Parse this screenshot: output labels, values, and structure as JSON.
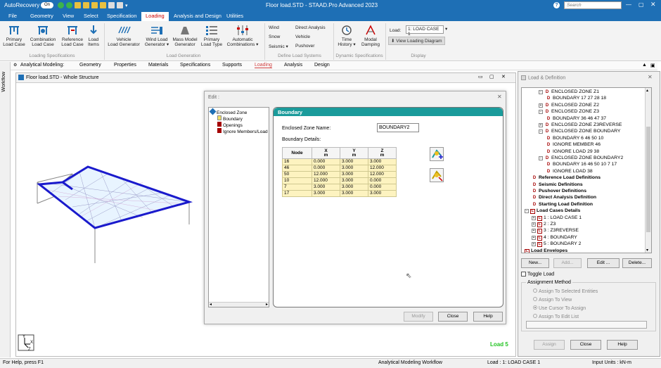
{
  "title_bar": {
    "app_name": "AutoRecovery",
    "toggle_state": "On",
    "document_title": "Floor load.STD - STAAD.Pro Advanced 2023",
    "search_placeholder": "Search"
  },
  "menu": {
    "items": [
      "File",
      "Geometry",
      "View",
      "Select",
      "Specification",
      "Loading",
      "Analysis and Design",
      "Utilities"
    ],
    "active": "Loading"
  },
  "ribbon": {
    "loading_specifications": {
      "group_label": "Loading Specifications",
      "buttons": [
        {
          "line1": "Primary",
          "line2": "Load Case"
        },
        {
          "line1": "Combination",
          "line2": "Load Case"
        },
        {
          "line1": "Reference",
          "line2": "Load Case"
        },
        {
          "line1": "Load",
          "line2": "Items"
        }
      ]
    },
    "load_generation": {
      "group_label": "Load Generation",
      "buttons": [
        {
          "line1": "Vehicle",
          "line2": "Load Generator"
        },
        {
          "line1": "Wind Load",
          "line2": "Generator ▾"
        },
        {
          "line1": "Mass Model",
          "line2": "Generator"
        },
        {
          "line1": "Primary",
          "line2": "Load Type"
        },
        {
          "line1": "Automatic",
          "line2": "Combinations ▾"
        }
      ]
    },
    "define_load_systems": {
      "group_label": "Define Load Systems",
      "items": [
        "Wind",
        "Snow",
        "Seismic ▾",
        "Direct Analysis",
        "Vehicle",
        "Pushover"
      ]
    },
    "dynamic_specifications": {
      "group_label": "Dynamic Specifications",
      "buttons": [
        {
          "line1": "Time",
          "line2": "History ▾"
        },
        {
          "line1": "Modal",
          "line2": "Damping"
        }
      ]
    },
    "display": {
      "group_label": "Display",
      "load_label": "Load:",
      "load_value": "1: LOAD CASE 1",
      "view_diagram": "View Loading Diagram"
    }
  },
  "workflow_bar": {
    "items": [
      "Analytical Modeling:",
      "Geometry",
      "Properties",
      "Materials",
      "Specifications",
      "Supports",
      "Loading",
      "Analysis",
      "Design"
    ],
    "active": "Loading",
    "side_label": "Workflow"
  },
  "structure_window": {
    "title": "Floor load.STD - Whole Structure",
    "load_indicator": "Load 5",
    "axis_x": "X",
    "axis_y": "Y",
    "axis_z": "Z"
  },
  "edit_dialog": {
    "title": "Edit :",
    "tree": [
      "Enclosed Zone",
      "Boundary",
      "Openings",
      "Ignore Members/Load"
    ],
    "panel_title": "Boundary",
    "zone_name_label": "Enclosed Zone Name:",
    "zone_name_value": "BOUNDARY2",
    "details_label": "Boundary Details:",
    "columns": [
      {
        "name": "Node",
        "unit": ""
      },
      {
        "name": "X",
        "unit": "m"
      },
      {
        "name": "Y",
        "unit": "m"
      },
      {
        "name": "Z",
        "unit": "m"
      }
    ],
    "rows": [
      [
        "16",
        "0.000",
        "3.000",
        "3.000"
      ],
      [
        "46",
        "0.000",
        "3.000",
        "12.000"
      ],
      [
        "50",
        "12.000",
        "3.000",
        "12.000"
      ],
      [
        "10",
        "12.000",
        "3.000",
        "0.000"
      ],
      [
        "7",
        "3.000",
        "3.000",
        "0.000"
      ],
      [
        "17",
        "3.000",
        "3.000",
        "3.000"
      ]
    ],
    "buttons": {
      "modify": "Modify",
      "close": "Close",
      "help": "Help"
    }
  },
  "load_panel": {
    "title": "Load & Definition",
    "tree": [
      {
        "indent": 2,
        "type": "D",
        "expand": "-",
        "text": "ENCLOSED ZONE Z1",
        "bold": false
      },
      {
        "indent": 3,
        "type": "D",
        "expand": "",
        "text": "BOUNDARY 17 27 28 18",
        "bold": false
      },
      {
        "indent": 2,
        "type": "D",
        "expand": "+",
        "text": "ENCLOSED ZONE Z2",
        "bold": false
      },
      {
        "indent": 2,
        "type": "D",
        "expand": "-",
        "text": "ENCLOSED ZONE Z3",
        "bold": false
      },
      {
        "indent": 3,
        "type": "D",
        "expand": "",
        "text": "BOUNDARY 36 46 47 37",
        "bold": false
      },
      {
        "indent": 2,
        "type": "D",
        "expand": "+",
        "text": "ENCLOSED ZONE Z3REVERSE",
        "bold": false
      },
      {
        "indent": 2,
        "type": "D",
        "expand": "-",
        "text": "ENCLOSED ZONE BOUNDARY",
        "bold": false
      },
      {
        "indent": 3,
        "type": "D",
        "expand": "",
        "text": "BOUNDARY 6 46 50 10",
        "bold": false
      },
      {
        "indent": 3,
        "type": "D",
        "expand": "",
        "text": "IGNORE MEMBER 46",
        "bold": false
      },
      {
        "indent": 3,
        "type": "D",
        "expand": "",
        "text": "IGNORE LOAD 29 38",
        "bold": false
      },
      {
        "indent": 2,
        "type": "D",
        "expand": "-",
        "text": "ENCLOSED ZONE BOUNDARY2",
        "bold": false
      },
      {
        "indent": 3,
        "type": "D",
        "expand": "",
        "text": "BOUNDARY 16 46 50 10 7 17",
        "bold": false
      },
      {
        "indent": 3,
        "type": "D",
        "expand": "",
        "text": "IGNORE LOAD 38",
        "bold": false
      },
      {
        "indent": 1,
        "type": "D",
        "expand": "",
        "text": "Reference Load Definitions",
        "bold": true
      },
      {
        "indent": 1,
        "type": "D",
        "expand": "",
        "text": "Seismic Definitions",
        "bold": true
      },
      {
        "indent": 1,
        "type": "D",
        "expand": "",
        "text": "Pushover Definitions",
        "bold": true
      },
      {
        "indent": 1,
        "type": "D",
        "expand": "",
        "text": "Direct Analysis Definition",
        "bold": true
      },
      {
        "indent": 1,
        "type": "D",
        "expand": "",
        "text": "Starting Load Definition",
        "bold": true
      },
      {
        "indent": 0,
        "type": "L",
        "expand": "-",
        "text": "Load Cases Details",
        "bold": true
      },
      {
        "indent": 1,
        "type": "L",
        "expand": "+",
        "text": "1 : LOAD CASE 1",
        "bold": false
      },
      {
        "indent": 1,
        "type": "L",
        "expand": "+",
        "text": "2 : Z3",
        "bold": false
      },
      {
        "indent": 1,
        "type": "L",
        "expand": "+",
        "text": "3 : Z3REVERSE",
        "bold": false
      },
      {
        "indent": 1,
        "type": "L",
        "expand": "+",
        "text": "4 : BOUNDARY",
        "bold": false
      },
      {
        "indent": 1,
        "type": "L",
        "expand": "+",
        "text": "5 : BOUNDARY 2",
        "bold": false
      },
      {
        "indent": 0,
        "type": "L",
        "expand": "",
        "text": "Load Envelopes",
        "bold": true
      }
    ],
    "buttons": {
      "new": "New...",
      "add": "Add...",
      "edit": "Edit ...",
      "delete": "Delete..."
    },
    "toggle_load": "Toggle Load",
    "assignment_method": "Assignment Method",
    "options": [
      "Assign To Selected Entities",
      "Assign To View",
      "Use Cursor To Assign",
      "Assign To Edit List"
    ],
    "selected_option": "Use Cursor To Assign",
    "bottom_buttons": {
      "assign": "Assign",
      "close": "Close",
      "help": "Help"
    }
  },
  "status_bar": {
    "help": "For Help, press F1",
    "workflow": "Analytical Modeling Workflow",
    "load": "Load : 1: LOAD CASE 1",
    "units": "Input Units : kN-m"
  },
  "colors": {
    "accent_blue": "#1e6fb5",
    "teal_header": "#1a9b9b",
    "grid_yellow": "#fdf3c0",
    "load_green": "#22c322",
    "tree_red": "#a40000"
  }
}
